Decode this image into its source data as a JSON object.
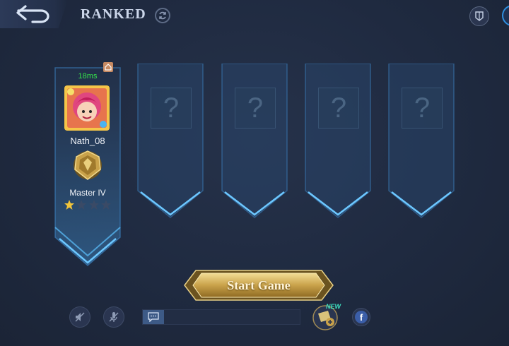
{
  "header": {
    "title": "RANKED",
    "back_icon": "back-arrow-icon",
    "refresh_icon": "refresh-icon",
    "right_icon": "shield-icon"
  },
  "lobby": {
    "player": {
      "ping": "18ms",
      "name": "Nath_08",
      "rank": "Master IV",
      "stars_filled": 1,
      "stars_total": 4
    },
    "empty_slots": [
      {
        "placeholder": "?"
      },
      {
        "placeholder": "?"
      },
      {
        "placeholder": "?"
      },
      {
        "placeholder": "?"
      }
    ]
  },
  "actions": {
    "start_label": "Start Game",
    "new_badge": "NEW",
    "facebook_label": "f"
  },
  "colors": {
    "background": "#1f2a40",
    "ping": "#35e04a",
    "gold": "#d9b75a",
    "slot_border": "#3d86c6"
  }
}
